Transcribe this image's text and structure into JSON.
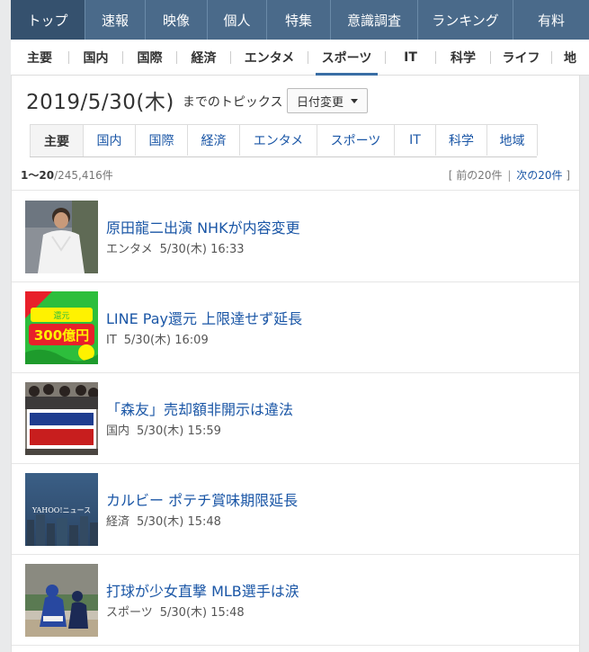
{
  "top_nav": [
    {
      "label": "トップ",
      "active": true
    },
    {
      "label": "速報",
      "active": false
    },
    {
      "label": "映像",
      "active": false
    },
    {
      "label": "個人",
      "active": false
    },
    {
      "label": "特集",
      "active": false
    },
    {
      "label": "意識調査",
      "active": false
    },
    {
      "label": "ランキング",
      "active": false
    },
    {
      "label": "有料",
      "active": false
    }
  ],
  "sub_nav": [
    {
      "label": "主要",
      "active": false
    },
    {
      "label": "国内",
      "active": false
    },
    {
      "label": "国際",
      "active": false
    },
    {
      "label": "経済",
      "active": false
    },
    {
      "label": "エンタメ",
      "active": false
    },
    {
      "label": "スポーツ",
      "active": true
    },
    {
      "label": "IT",
      "active": false
    },
    {
      "label": "科学",
      "active": false
    },
    {
      "label": "ライフ",
      "active": false
    },
    {
      "label": "地",
      "active": false
    }
  ],
  "header": {
    "date": "2019/5/30(木)",
    "suffix": "までのトピックス",
    "date_button": "日付変更"
  },
  "category_tabs": [
    {
      "label": "主要",
      "active": true
    },
    {
      "label": "国内",
      "active": false
    },
    {
      "label": "国際",
      "active": false
    },
    {
      "label": "経済",
      "active": false
    },
    {
      "label": "エンタメ",
      "active": false
    },
    {
      "label": "スポーツ",
      "active": false
    },
    {
      "label": "IT",
      "active": false
    },
    {
      "label": "科学",
      "active": false
    },
    {
      "label": "地域",
      "active": false
    }
  ],
  "pagination": {
    "range": "1〜20",
    "total": "/245,416件",
    "open_bracket": "[",
    "prev": "前の20件",
    "divider": "|",
    "next": "次の20件",
    "close_bracket": "]"
  },
  "news": [
    {
      "title": "原田龍二出演 NHKが内容変更",
      "category": "エンタメ",
      "time": "5/30(木) 16:33",
      "thumb_icon": "person-photo"
    },
    {
      "title": "LINE Pay還元 上限達せず延長",
      "category": "IT",
      "time": "5/30(木) 16:09",
      "thumb_icon": "line-pay-banner"
    },
    {
      "title": "「森友」売却額非開示は違法",
      "category": "国内",
      "time": "5/30(木) 15:59",
      "thumb_icon": "protest-photo"
    },
    {
      "title": "カルビー ポテチ賞味期限延長",
      "category": "経済",
      "time": "5/30(木) 15:48",
      "thumb_icon": "yahoo-news-placeholder"
    },
    {
      "title": "打球が少女直撃 MLB選手は涙",
      "category": "スポーツ",
      "time": "5/30(木) 15:48",
      "thumb_icon": "baseball-photo"
    }
  ],
  "thumb_texts": {
    "line_top": "還元",
    "line_big": "300億円",
    "yahoo": "YAHOO!ニュース"
  }
}
